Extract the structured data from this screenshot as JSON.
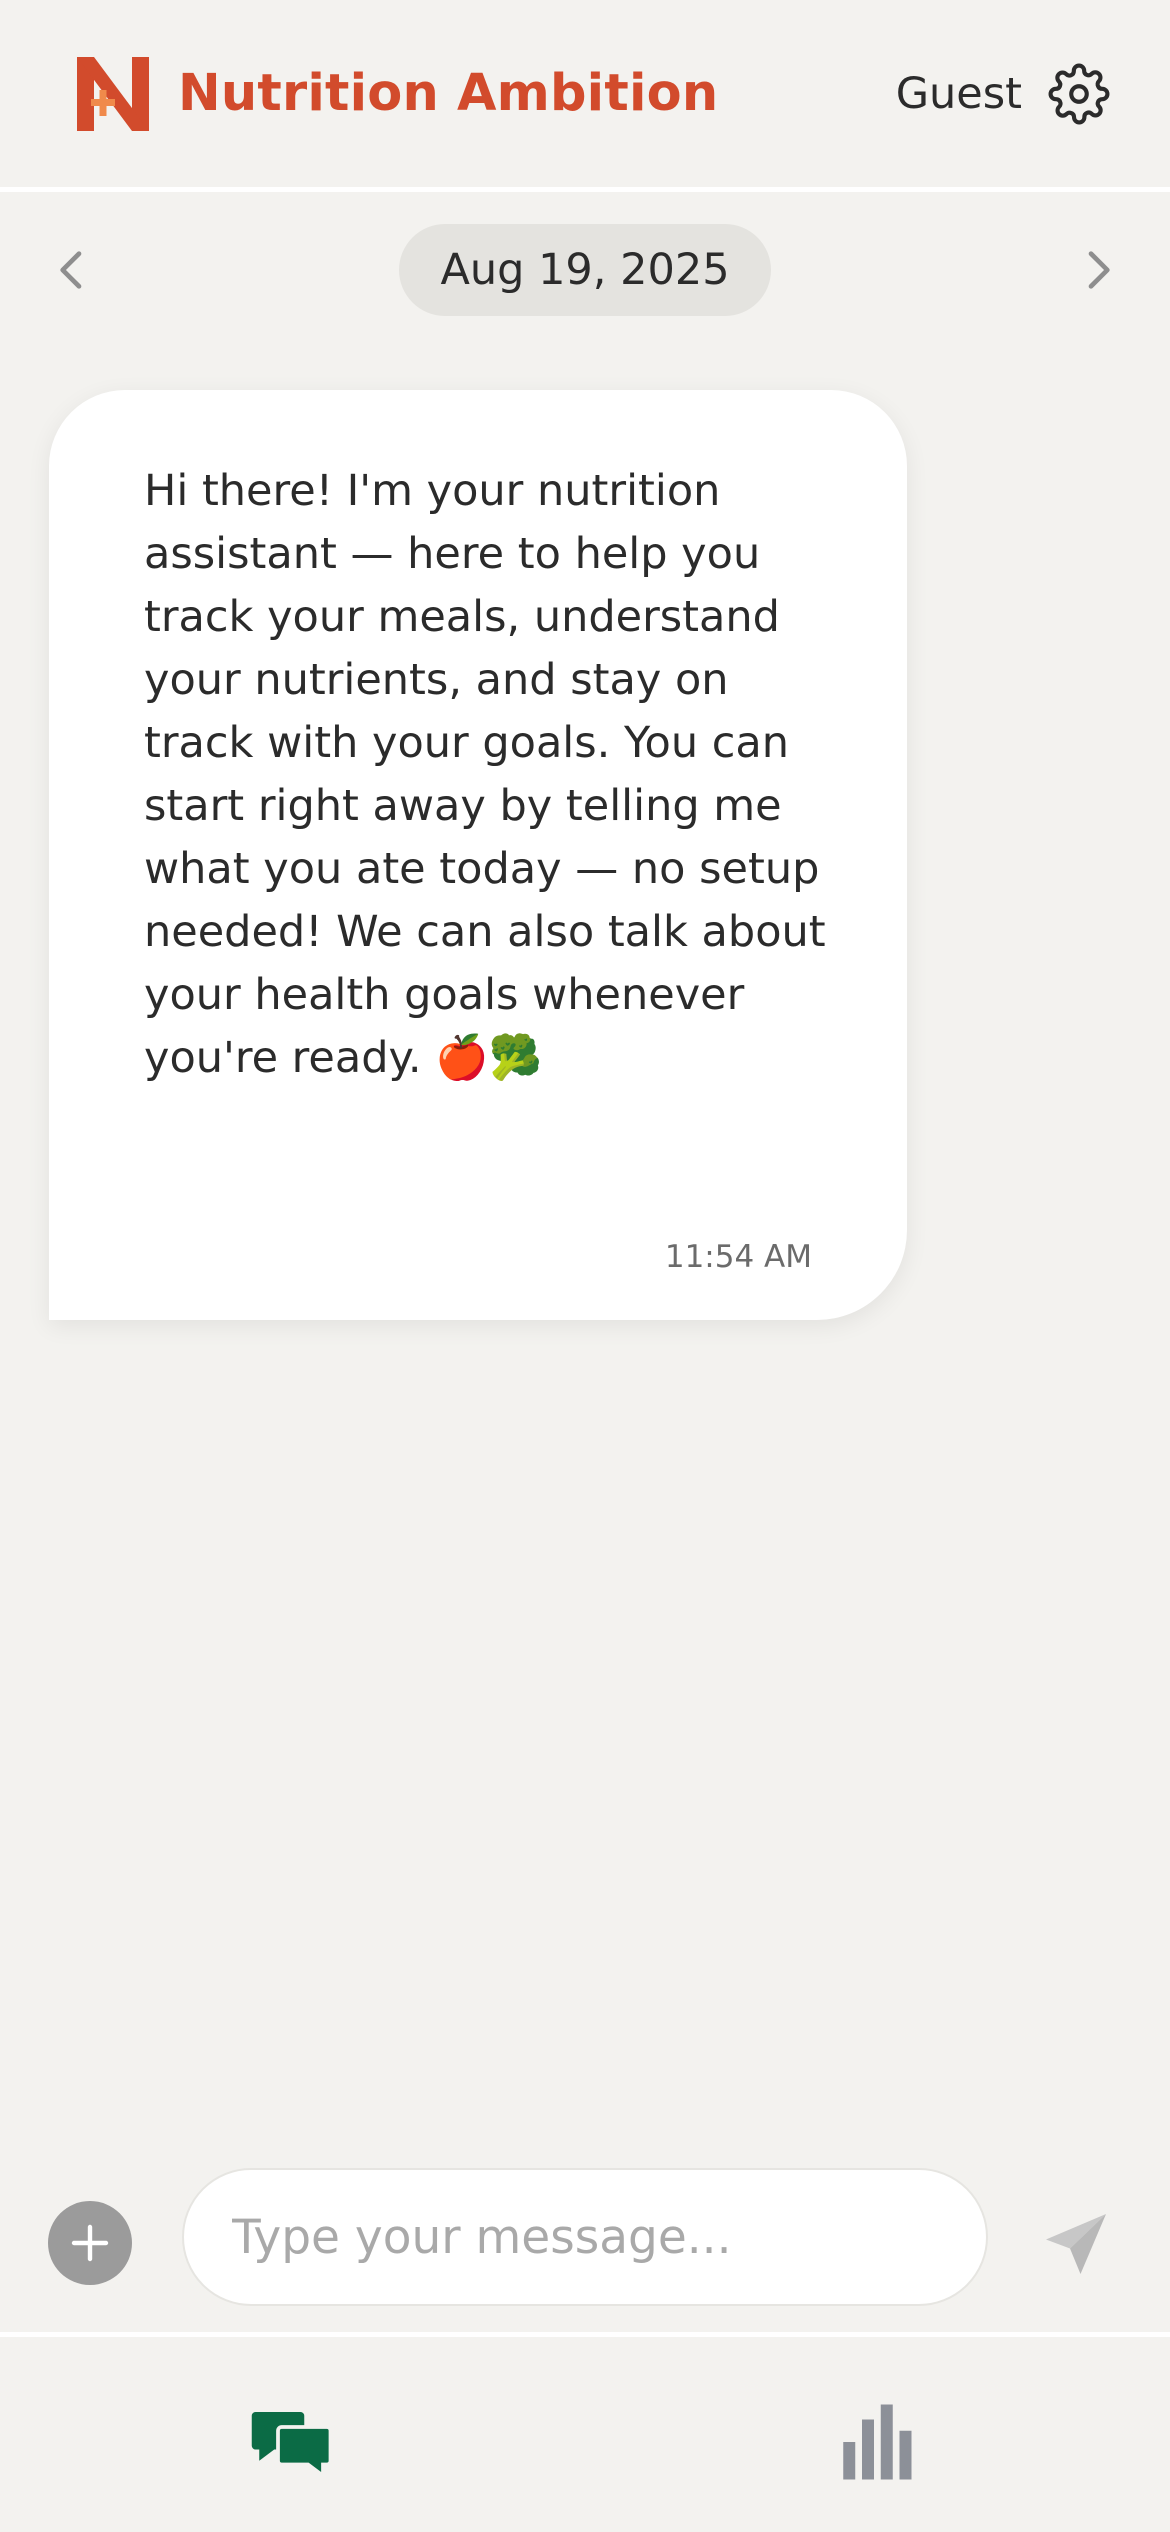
{
  "header": {
    "logo_icon": "nutrition-ambition-logo",
    "app_name": "Nutrition Ambition",
    "user_name": "Guest",
    "settings_icon": "gear-icon"
  },
  "date_nav": {
    "current_date": "Aug 19, 2025",
    "prev_icon": "chevron-left-icon",
    "next_icon": "chevron-right-icon"
  },
  "messages": [
    {
      "sender": "assistant",
      "text": "Hi there! I'm your nutrition assistant — here to help you track your meals, understand your nutrients, and stay on track with your goals. You can start right away by telling me what you ate today — no setup needed! We can also talk about your health goals whenever you're ready. 🍎🥦",
      "time": "11:54 AM"
    }
  ],
  "composer": {
    "placeholder": "Type your message...",
    "value": "",
    "add_icon": "plus-icon",
    "send_icon": "send-icon"
  },
  "bottom_nav": {
    "tabs": [
      {
        "id": "chat",
        "icon": "chat-bubbles-icon",
        "active": true
      },
      {
        "id": "stats",
        "icon": "bar-chart-icon",
        "active": false
      }
    ]
  },
  "colors": {
    "brand": "#d24b2c",
    "background": "#f3f2ef",
    "active_tab": "#0b6b45",
    "inactive_tab": "#8c9098"
  }
}
